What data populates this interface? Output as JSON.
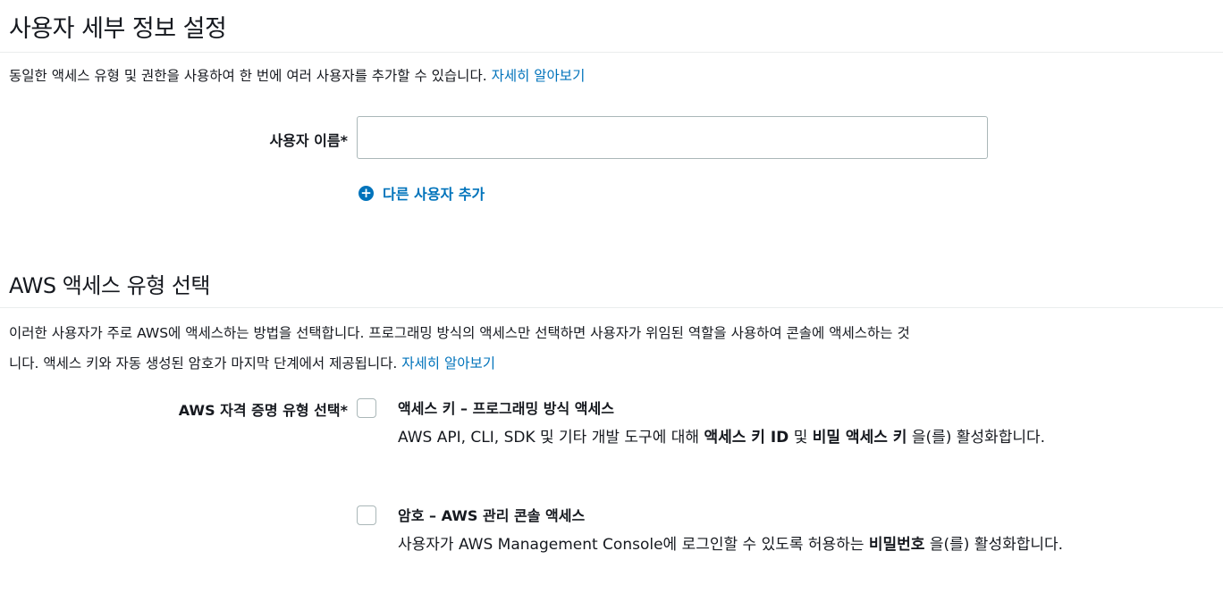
{
  "user_details": {
    "title": "사용자 세부 정보 설정",
    "description": "동일한 액세스 유형 및 권한을 사용하여 한 번에 여러 사용자를 추가할 수 있습니다.",
    "learn_more": "자세히 알아보기",
    "username_label": "사용자 이름*",
    "username_value": "",
    "add_user_label": "다른 사용자 추가"
  },
  "access_type": {
    "title": "AWS 액세스 유형 선택",
    "description_line1": "이러한 사용자가 주로 AWS에 액세스하는 방법을 선택합니다. 프로그래밍 방식의 액세스만 선택하면 사용자가 위임된 역할을 사용하여 콘솔에 액세스하는 것",
    "description_line2": "니다. 액세스 키와 자동 생성된 암호가 마지막 단계에서 제공됩니다.",
    "learn_more": "자세히 알아보기",
    "credential_label": "AWS 자격 증명 유형 선택*",
    "options": [
      {
        "title": "액세스 키 – 프로그래밍 방식 액세스",
        "desc_prefix": "AWS API, CLI, SDK 및 기타 개발 도구에 대해",
        "bold1": "액세스 키 ID",
        "mid": "및",
        "bold2": "비밀 액세스 키",
        "desc_suffix": "을(를) 활성화합니다.",
        "checked": false
      },
      {
        "title": "암호 – AWS 관리 콘솔 액세스",
        "desc_prefix": "사용자가 AWS Management Console에 로그인할 수 있도록 허용하는",
        "bold1": "비밀번호",
        "desc_suffix": "을(를) 활성화합니다.",
        "checked": false
      }
    ]
  },
  "colors": {
    "link": "#0073bb",
    "text": "#16191f",
    "border": "#aab7b8"
  }
}
